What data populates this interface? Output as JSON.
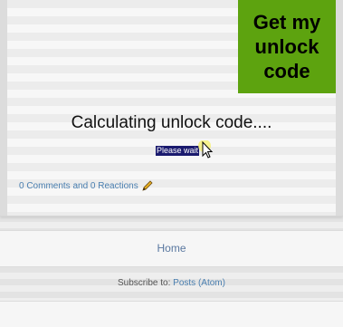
{
  "promo": {
    "label": "Get my\nunlock\ncode",
    "color": "#5da30f"
  },
  "status": {
    "calculating": "Calculating unlock code....",
    "please_wait": "Please wait"
  },
  "post_footer": {
    "comments_link": "0 Comments and 0 Reactions"
  },
  "nav": {
    "home": "Home"
  },
  "subscribe": {
    "prefix": "Subscribe to: ",
    "link": "Posts (Atom)"
  },
  "icons": {
    "edit": "pencil-icon",
    "cursor": "mouse-cursor-icon"
  }
}
